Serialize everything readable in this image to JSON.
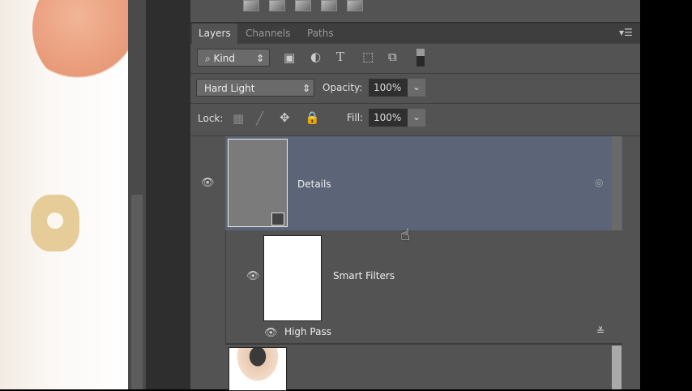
{
  "panel": {
    "tabs": [
      "Layers",
      "Channels",
      "Paths"
    ],
    "filter": {
      "kind_label": "Kind"
    },
    "blend_mode": "Hard Light",
    "opacity_label": "Opacity:",
    "opacity_value": "100%",
    "lock_label": "Lock:",
    "fill_label": "Fill:",
    "fill_value": "100%"
  },
  "layers": [
    {
      "name": "Details",
      "selected": true
    },
    {
      "name": "Smart Filters"
    },
    {
      "name": "High Pass"
    }
  ],
  "colors": {
    "selection": "#5b6577",
    "panel": "#535353"
  }
}
